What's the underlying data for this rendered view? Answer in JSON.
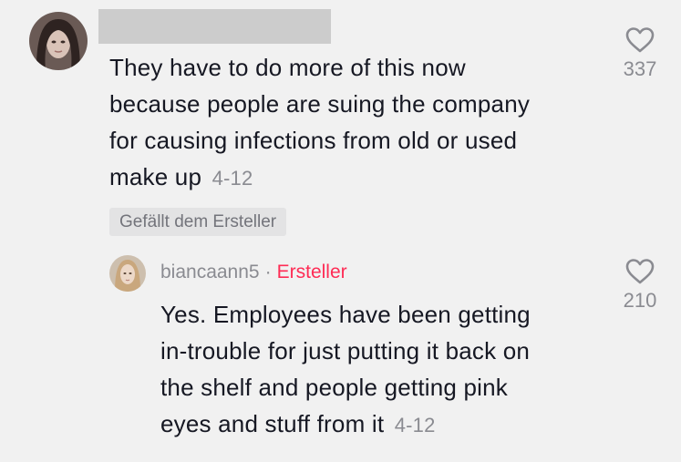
{
  "comment": {
    "text_lines": [
      "They have to do more of this now",
      "because people are suing the company",
      "for causing infections from old or used",
      "make up"
    ],
    "date": "4-12",
    "liked_by_creator_label": "Gefällt dem Ersteller",
    "like_count": "337",
    "like_icon": "heart-outline-icon"
  },
  "reply": {
    "username": "biancaann5",
    "separator": "·",
    "creator_label": "Ersteller",
    "text_lines": [
      "Yes. Employees have been getting",
      "in-trouble for just putting it back on",
      "the shelf and people getting pink",
      "eyes and stuff from it"
    ],
    "date": "4-12",
    "like_count": "210",
    "like_icon": "heart-outline-icon"
  },
  "colors": {
    "background": "#f1f1f1",
    "text": "#161823",
    "secondary_text": "#8a8b91",
    "creator_accent": "#fe2c55",
    "badge_background": "#e3e3e4",
    "redaction": "#cccccc"
  }
}
